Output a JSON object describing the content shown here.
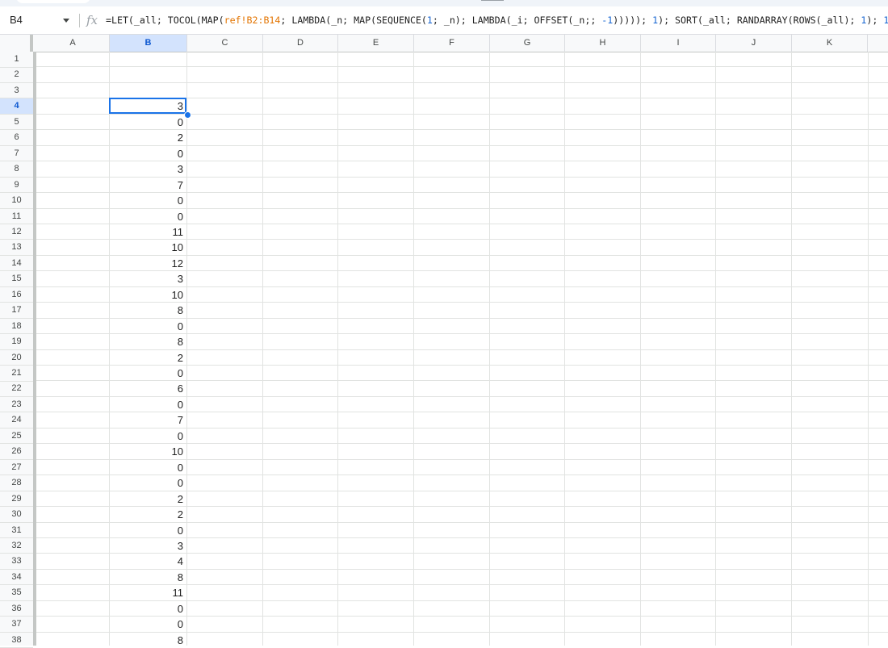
{
  "name_box": {
    "value": "B4"
  },
  "formula_bar": {
    "fx_label": "fx",
    "formula": "=LET(_all; TOCOL(MAP(ref!B2:B14; LAMBDA(_n; MAP(SEQUENCE(1; _n); LAMBDA(_i; OFFSET(_n;; -1))))); 1); SORT(_all; RANDARRAY(ROWS(_all); 1); 1))",
    "parts": [
      {
        "text": "=LET(_all; TOCOL(MAP(",
        "style": "plain"
      },
      {
        "text": "ref!B2:B14",
        "style": "ref"
      },
      {
        "text": "; LAMBDA(_n; MAP(SEQUENCE(",
        "style": "plain"
      },
      {
        "text": "1",
        "style": "num"
      },
      {
        "text": "; _n); LAMBDA(_i; OFFSET(_n;; ",
        "style": "plain"
      },
      {
        "text": "-1",
        "style": "num"
      },
      {
        "text": "))))); ",
        "style": "plain"
      },
      {
        "text": "1",
        "style": "num"
      },
      {
        "text": "); SORT(_all; RANDARRAY(ROWS(_all); ",
        "style": "plain"
      },
      {
        "text": "1",
        "style": "num"
      },
      {
        "text": "); ",
        "style": "plain"
      },
      {
        "text": "1",
        "style": "num"
      },
      {
        "text": "))",
        "style": "plain"
      }
    ]
  },
  "columns": [
    "A",
    "B",
    "C",
    "D",
    "E",
    "F",
    "G",
    "H",
    "I",
    "J",
    "K"
  ],
  "selected_column": "B",
  "rows": [
    "1",
    "2",
    "3",
    "4",
    "5",
    "6",
    "7",
    "8",
    "9",
    "10",
    "11",
    "12",
    "13",
    "14",
    "15",
    "16",
    "17",
    "18",
    "19",
    "20",
    "21",
    "22",
    "23",
    "24",
    "25",
    "26",
    "27",
    "28",
    "29",
    "30",
    "31",
    "32",
    "33",
    "34",
    "35",
    "36",
    "37",
    "38"
  ],
  "selected_row": "4",
  "active_cell": "B4",
  "column_b_values": {
    "4": "3",
    "5": "0",
    "6": "2",
    "7": "0",
    "8": "3",
    "9": "7",
    "10": "0",
    "11": "0",
    "12": "11",
    "13": "10",
    "14": "12",
    "15": "3",
    "16": "10",
    "17": "8",
    "18": "0",
    "19": "8",
    "20": "2",
    "21": "0",
    "22": "6",
    "23": "0",
    "24": "7",
    "25": "0",
    "26": "10",
    "27": "0",
    "28": "0",
    "29": "2",
    "30": "2",
    "31": "0",
    "32": "3",
    "33": "4",
    "34": "8",
    "35": "11",
    "36": "0",
    "37": "0",
    "38": "8"
  },
  "colors": {
    "accent": "#1a73e8",
    "selected_header_bg": "#d3e3fd",
    "ref_color": "#e37400",
    "number_color": "#1967d2"
  }
}
